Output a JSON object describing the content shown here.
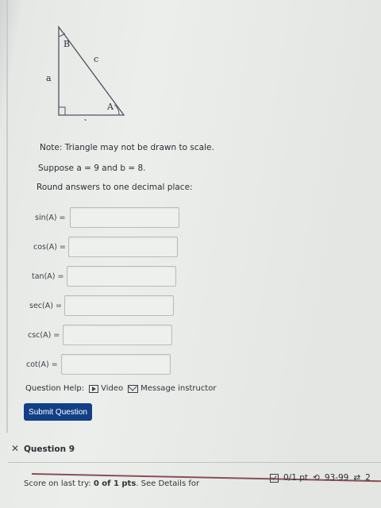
{
  "figure": {
    "label_B": "B",
    "label_c": "c",
    "label_a": "a",
    "label_A": "A",
    "label_b": "b"
  },
  "note": "Note: Triangle may not be drawn to scale.",
  "suppose": "Suppose a = 9 and b = 8.",
  "round": "Round answers to one decimal place:",
  "answers": [
    {
      "label": "sin(A) =",
      "value": ""
    },
    {
      "label": "cos(A) =",
      "value": ""
    },
    {
      "label": "tan(A) =",
      "value": ""
    },
    {
      "label": "sec(A) =",
      "value": ""
    },
    {
      "label": "csc(A) =",
      "value": ""
    },
    {
      "label": "cot(A) =",
      "value": ""
    }
  ],
  "help": {
    "label": "Question Help:",
    "video": "Video",
    "message": "Message instructor"
  },
  "submit_label": "Submit Question",
  "next_question": {
    "close_symbol": "✕",
    "title": "Question 9"
  },
  "footer": {
    "score_prefix": "Score on last try: ",
    "score_value": "0 of 1 pts",
    "score_suffix": ". See Details for",
    "points": "0/1 pt",
    "attempts": "93-99",
    "retries": "2"
  }
}
